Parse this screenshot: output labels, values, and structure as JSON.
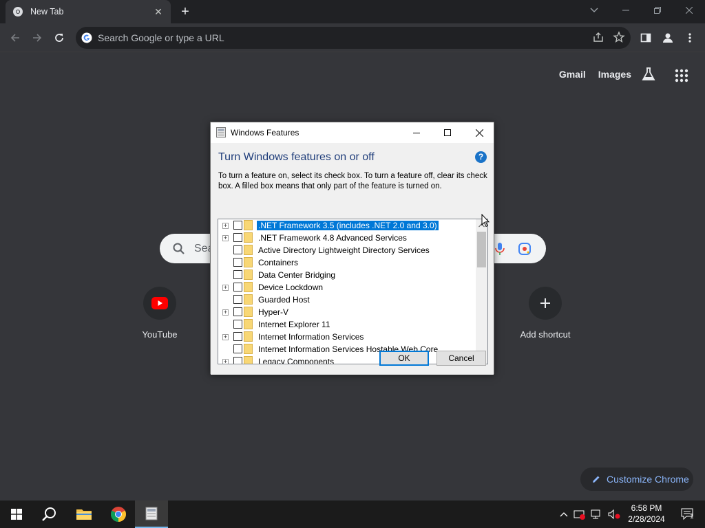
{
  "chrome": {
    "tab_title": "New Tab",
    "omnibox_placeholder": "Search Google or type a URL"
  },
  "ntp": {
    "links": [
      "Gmail",
      "Images"
    ],
    "search_placeholder": "Sea",
    "shortcuts": [
      {
        "label": "YouTube",
        "icon": "youtube-icon"
      },
      {
        "label": "Add shortcut",
        "icon": "plus-icon"
      }
    ],
    "customize_label": "Customize Chrome"
  },
  "dialog": {
    "title": "Windows Features",
    "heading": "Turn Windows features on or off",
    "help_glyph": "?",
    "description": "To turn a feature on, select its check box. To turn a feature off, clear its check box. A filled box means that only part of the feature is turned on.",
    "features": [
      {
        "label": ".NET Framework 3.5 (includes .NET 2.0 and 3.0)",
        "expandable": true,
        "checked": false,
        "selected": true
      },
      {
        "label": ".NET Framework 4.8 Advanced Services",
        "expandable": true,
        "checked": false,
        "selected": false
      },
      {
        "label": "Active Directory Lightweight Directory Services",
        "expandable": false,
        "checked": false,
        "selected": false
      },
      {
        "label": "Containers",
        "expandable": false,
        "checked": false,
        "selected": false
      },
      {
        "label": "Data Center Bridging",
        "expandable": false,
        "checked": false,
        "selected": false
      },
      {
        "label": "Device Lockdown",
        "expandable": true,
        "checked": false,
        "selected": false
      },
      {
        "label": "Guarded Host",
        "expandable": false,
        "checked": false,
        "selected": false
      },
      {
        "label": "Hyper-V",
        "expandable": true,
        "checked": false,
        "selected": false
      },
      {
        "label": "Internet Explorer 11",
        "expandable": false,
        "checked": false,
        "selected": false
      },
      {
        "label": "Internet Information Services",
        "expandable": true,
        "checked": false,
        "selected": false
      },
      {
        "label": "Internet Information Services Hostable Web Core",
        "expandable": false,
        "checked": false,
        "selected": false
      },
      {
        "label": "Legacy Components",
        "expandable": true,
        "checked": false,
        "selected": false
      }
    ],
    "ok_label": "OK",
    "cancel_label": "Cancel"
  },
  "taskbar": {
    "time": "6:58 PM",
    "date": "2/28/2024",
    "notification_count": "1"
  },
  "colors": {
    "chrome_bg": "#35363a",
    "tabstrip_bg": "#202124",
    "accent_blue": "#8ab4f8",
    "selection_blue": "#0078d7",
    "dialog_heading": "#1f3d7a"
  }
}
